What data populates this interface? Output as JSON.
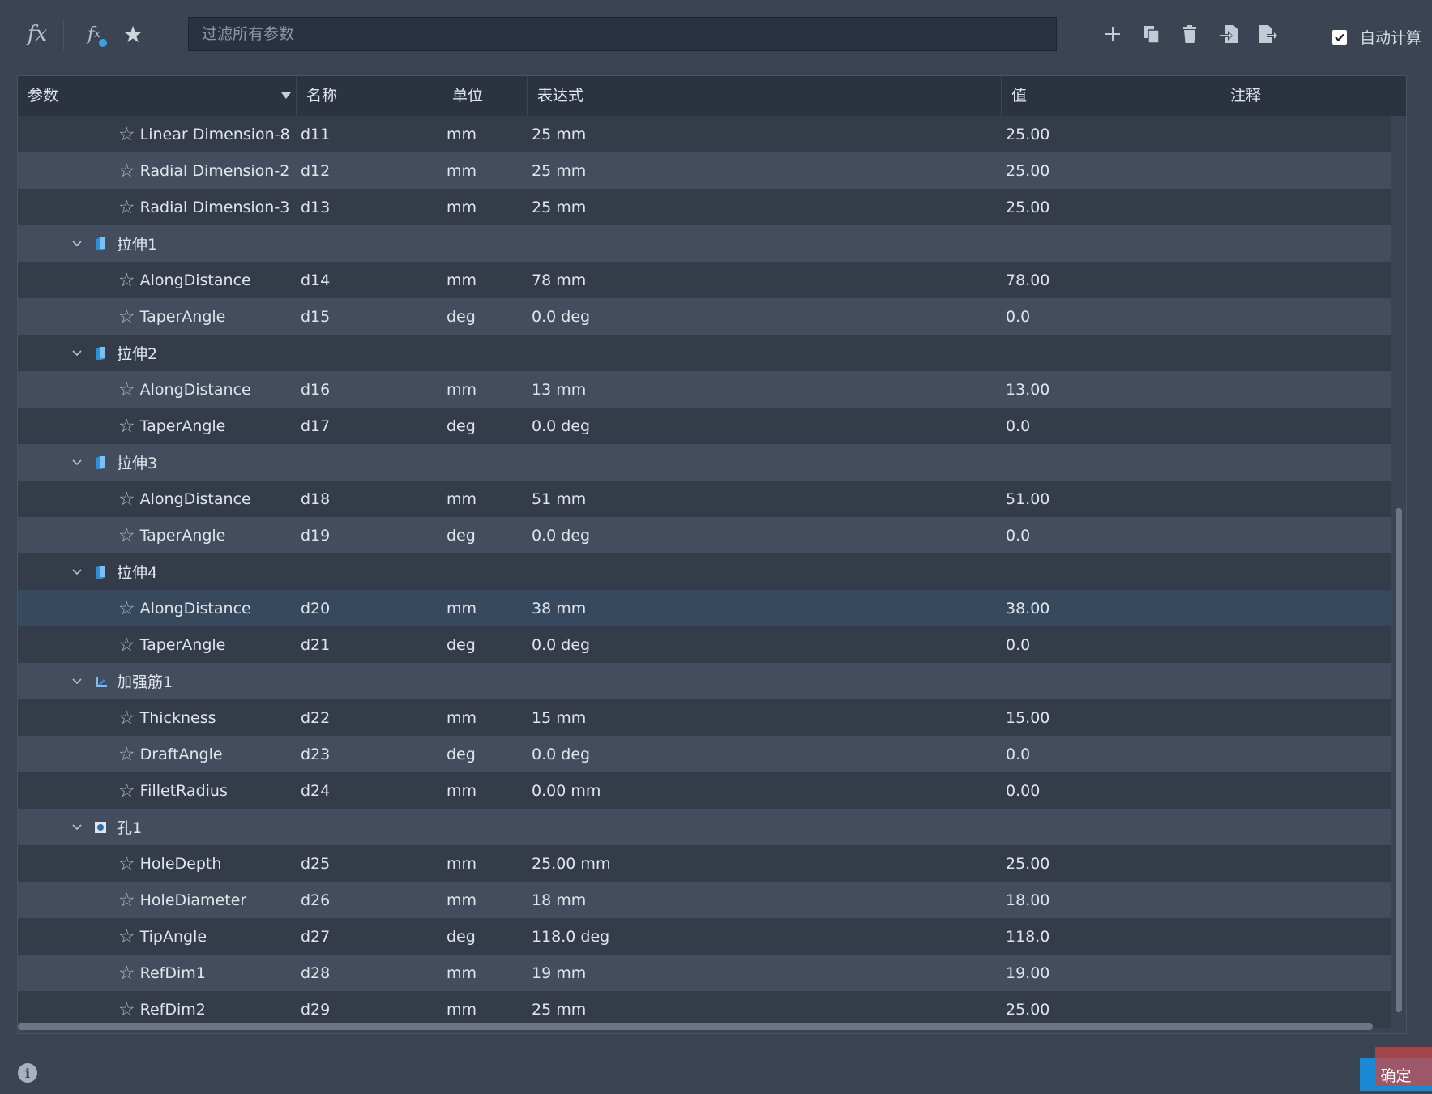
{
  "toolbar": {
    "filter_placeholder": "过滤所有参数",
    "auto_calc_label": "自动计算",
    "auto_calc_checked": true,
    "icons": [
      "fx-icon",
      "fx-user-icon",
      "star-icon",
      "add-icon",
      "copy-icon",
      "delete-icon",
      "import-icon",
      "export-icon"
    ]
  },
  "table": {
    "headers": {
      "param": "参数",
      "name": "名称",
      "unit": "单位",
      "expr": "表达式",
      "value": "值",
      "note": "注释"
    },
    "rows": [
      {
        "type": "param",
        "param": "Linear Dimension-8",
        "name": "d11",
        "unit": "mm",
        "expr": "25 mm",
        "value": "25.00"
      },
      {
        "type": "param",
        "param": "Radial Dimension-2",
        "name": "d12",
        "unit": "mm",
        "expr": "25 mm",
        "value": "25.00"
      },
      {
        "type": "param",
        "param": "Radial Dimension-3",
        "name": "d13",
        "unit": "mm",
        "expr": "25 mm",
        "value": "25.00"
      },
      {
        "type": "group",
        "label": "拉伸1",
        "icon": "extrude-icon"
      },
      {
        "type": "param",
        "param": "AlongDistance",
        "name": "d14",
        "unit": "mm",
        "expr": "78 mm",
        "value": "78.00"
      },
      {
        "type": "param",
        "param": "TaperAngle",
        "name": "d15",
        "unit": "deg",
        "expr": "0.0 deg",
        "value": "0.0"
      },
      {
        "type": "group",
        "label": "拉伸2",
        "icon": "extrude-icon"
      },
      {
        "type": "param",
        "param": "AlongDistance",
        "name": "d16",
        "unit": "mm",
        "expr": "13 mm",
        "value": "13.00"
      },
      {
        "type": "param",
        "param": "TaperAngle",
        "name": "d17",
        "unit": "deg",
        "expr": "0.0 deg",
        "value": "0.0"
      },
      {
        "type": "group",
        "label": "拉伸3",
        "icon": "extrude-icon"
      },
      {
        "type": "param",
        "param": "AlongDistance",
        "name": "d18",
        "unit": "mm",
        "expr": "51 mm",
        "value": "51.00"
      },
      {
        "type": "param",
        "param": "TaperAngle",
        "name": "d19",
        "unit": "deg",
        "expr": "0.0 deg",
        "value": "0.0"
      },
      {
        "type": "group",
        "label": "拉伸4",
        "icon": "extrude-icon"
      },
      {
        "type": "param",
        "param": "AlongDistance",
        "name": "d20",
        "unit": "mm",
        "expr": "38 mm",
        "value": "38.00",
        "selected": true
      },
      {
        "type": "param",
        "param": "TaperAngle",
        "name": "d21",
        "unit": "deg",
        "expr": "0.0 deg",
        "value": "0.0"
      },
      {
        "type": "group",
        "label": "加强筋1",
        "icon": "rib-icon"
      },
      {
        "type": "param",
        "param": "Thickness",
        "name": "d22",
        "unit": "mm",
        "expr": "15 mm",
        "value": "15.00"
      },
      {
        "type": "param",
        "param": "DraftAngle",
        "name": "d23",
        "unit": "deg",
        "expr": "0.0 deg",
        "value": "0.0"
      },
      {
        "type": "param",
        "param": "FilletRadius",
        "name": "d24",
        "unit": "mm",
        "expr": "0.00 mm",
        "value": "0.00"
      },
      {
        "type": "group",
        "label": "孔1",
        "icon": "hole-icon"
      },
      {
        "type": "param",
        "param": "HoleDepth",
        "name": "d25",
        "unit": "mm",
        "expr": "25.00 mm",
        "value": "25.00"
      },
      {
        "type": "param",
        "param": "HoleDiameter",
        "name": "d26",
        "unit": "mm",
        "expr": "18 mm",
        "value": "18.00"
      },
      {
        "type": "param",
        "param": "TipAngle",
        "name": "d27",
        "unit": "deg",
        "expr": "118.0 deg",
        "value": "118.0"
      },
      {
        "type": "param",
        "param": "RefDim1",
        "name": "d28",
        "unit": "mm",
        "expr": "19 mm",
        "value": "19.00"
      },
      {
        "type": "param",
        "param": "RefDim2",
        "name": "d29",
        "unit": "mm",
        "expr": "25 mm",
        "value": "25.00"
      }
    ]
  },
  "footer": {
    "ok_label": "确定"
  },
  "colors": {
    "background": "#3b4453",
    "header": "#2b3240",
    "row_dark": "#343c4a",
    "row_light": "#444d5d",
    "row_selected": "#36495d",
    "accent": "#1a8ad4"
  }
}
